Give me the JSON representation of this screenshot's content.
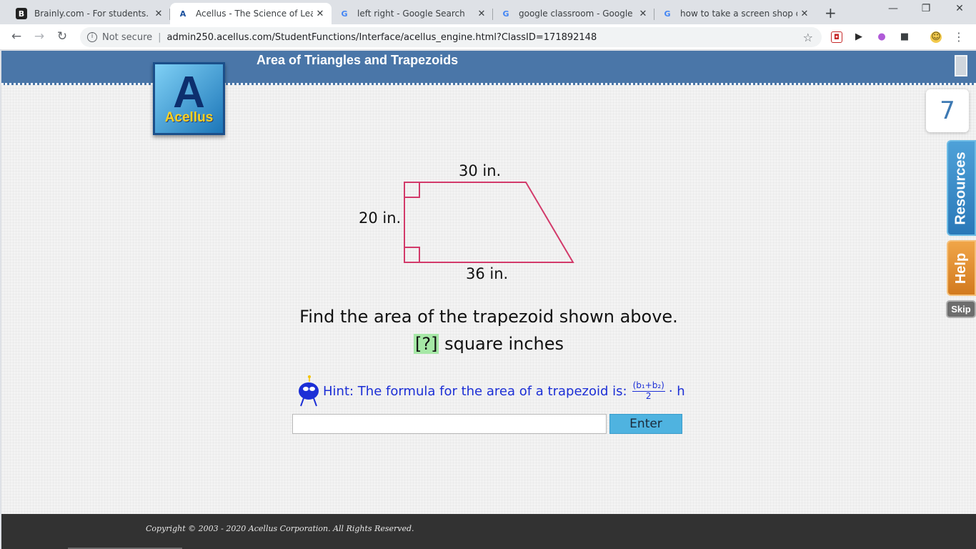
{
  "browser": {
    "tabs": [
      {
        "title": "Brainly.com - For students. By",
        "favicon": "B",
        "active": false
      },
      {
        "title": "Acellus - The Science of Learni",
        "favicon": "A",
        "active": true
      },
      {
        "title": "left right - Google Search",
        "favicon": "G",
        "active": false
      },
      {
        "title": "google classroom - Google Se",
        "favicon": "G",
        "active": false
      },
      {
        "title": "how to take a screen shop on",
        "favicon": "G",
        "active": false
      }
    ],
    "address": {
      "security_label": "Not secure",
      "url": "admin250.acellus.com/StudentFunctions/Interface/acellus_engine.html?ClassID=171892148"
    }
  },
  "header": {
    "lesson_title": "Area of Triangles and Trapezoids",
    "logo_text": "Acellus",
    "logo_mark": "A"
  },
  "sidebar": {
    "counter": "7",
    "resources_label": "Resources",
    "help_label": "Help",
    "skip_label": "Skip"
  },
  "problem": {
    "figure": {
      "top_label": "30 in.",
      "side_label": "20 in.",
      "bottom_label": "36 in."
    },
    "question": "Find the area of the trapezoid shown above.",
    "answer_blank": "[?]",
    "answer_unit": "square inches",
    "hint_prefix": "Hint: The formula for the area of a trapezoid is:",
    "hint_numerator": "(b₁+b₂)",
    "hint_denominator": "2",
    "hint_suffix": "· h",
    "answer_value": "",
    "enter_label": "Enter"
  },
  "footer": {
    "copyright": "Copyright © 2003 - 2020 Acellus Corporation.  All Rights Reserved."
  },
  "colors": {
    "header_blue": "#4a76a8",
    "trapezoid_stroke": "#d23a6a",
    "hint_blue": "#1c2fd6",
    "enter_button": "#4fb3e0",
    "answer_highlight": "#a6e8a6"
  }
}
